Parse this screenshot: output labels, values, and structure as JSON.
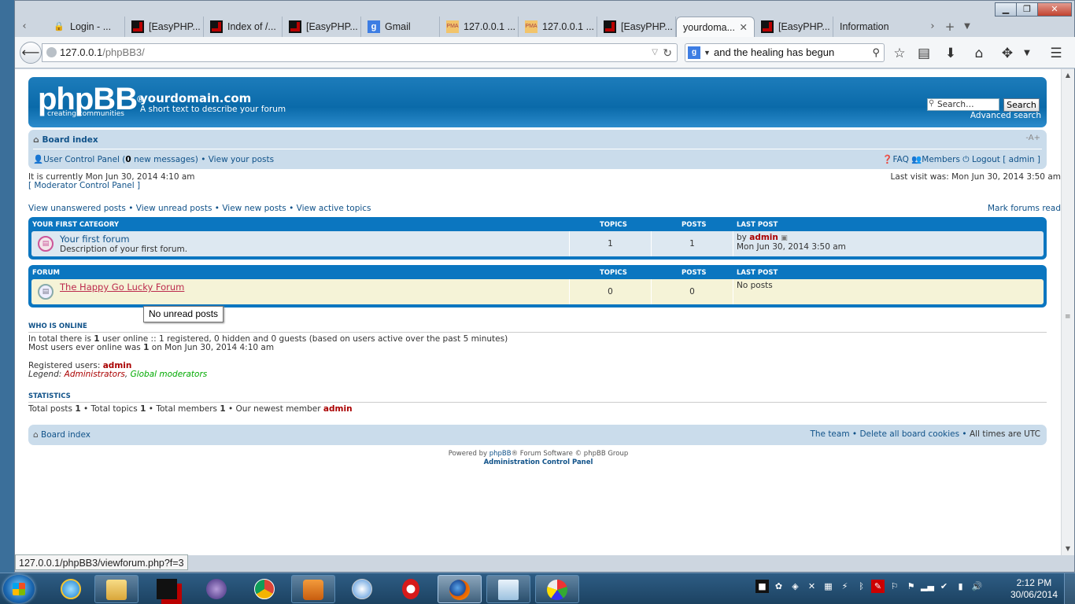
{
  "browser": {
    "tabs": [
      {
        "label": "Login - ...",
        "icon": "lock-icon"
      },
      {
        "label": "[EasyPHP...",
        "icon": "easyphp-icon"
      },
      {
        "label": "Index of /...",
        "icon": "easyphp-icon"
      },
      {
        "label": "[EasyPHP...",
        "icon": "easyphp-icon"
      },
      {
        "label": "Gmail",
        "icon": "google-icon"
      },
      {
        "label": "127.0.0.1 ...",
        "icon": "phpmyadmin-icon"
      },
      {
        "label": "127.0.0.1 ...",
        "icon": "phpmyadmin-icon"
      },
      {
        "label": "[EasyPHP...",
        "icon": "easyphp-icon"
      },
      {
        "label": "yourdoma...",
        "icon": "",
        "active": true
      },
      {
        "label": "[EasyPHP...",
        "icon": "easyphp-icon"
      },
      {
        "label": "Information",
        "icon": ""
      }
    ],
    "url_host": "127.0.0.1",
    "url_path": "/phpBB3/",
    "search_engine_letter": "g",
    "search_pma": "PMA",
    "search_text": "and the healing has begun",
    "status_url": "127.0.0.1/phpBB3/viewforum.php?f=3"
  },
  "header": {
    "logo": "phpBB",
    "logo_reg": "®",
    "logo_sub": "creating communities",
    "site_title": "yourdomain.com",
    "site_desc": "A short text to describe your forum",
    "search_placeholder": "Search…",
    "search_button": "Search",
    "advanced_search": "Advanced search"
  },
  "navbar": {
    "board_index": "Board index",
    "resize": "-A+",
    "ucp": "User Control Panel",
    "new_messages_count": "0",
    "new_messages_suffix": "new messages",
    "view_posts": "View your posts",
    "faq": "FAQ",
    "members": "Members",
    "logout": "Logout [ admin ]"
  },
  "info": {
    "current_time": "It is currently Mon Jun 30, 2014 4:10 am",
    "mcp": "[ Moderator Control Panel ]",
    "last_visit": "Last visit was: Mon Jun 30, 2014 3:50 am",
    "links": [
      "View unanswered posts",
      "View unread posts",
      "View new posts",
      "View active topics"
    ],
    "mark_read": "Mark forums read"
  },
  "categories": [
    {
      "name": "YOUR FIRST CATEGORY",
      "col_topics": "TOPICS",
      "col_posts": "POSTS",
      "col_last": "LAST POST",
      "forum": {
        "title": "Your first forum",
        "desc": "Description of your first forum.",
        "topics": "1",
        "posts": "1",
        "last_by": "by",
        "last_user": "admin",
        "last_time": "Mon Jun 30, 2014 3:50 am"
      }
    },
    {
      "name": "FORUM",
      "col_topics": "TOPICS",
      "col_posts": "POSTS",
      "col_last": "LAST POST",
      "forum": {
        "title": "The Happy Go Lucky Forum",
        "desc": "",
        "topics": "0",
        "posts": "0",
        "last_text": "No posts"
      }
    }
  ],
  "tooltip": "No unread posts",
  "online": {
    "heading": "WHO IS ONLINE",
    "line1_a": "In total there is",
    "line1_count": "1",
    "line1_b": "user online :: 1 registered, 0 hidden and 0 guests (based on users active over the past 5 minutes)",
    "line2_a": "Most users ever online was",
    "line2_count": "1",
    "line2_b": "on Mon Jun 30, 2014 4:10 am",
    "registered_label": "Registered users:",
    "registered_user": "admin",
    "legend_label": "Legend:",
    "legend_admins": "Administrators",
    "legend_mods": "Global moderators"
  },
  "stats": {
    "heading": "STATISTICS",
    "label_posts": "Total posts",
    "posts": "1",
    "label_topics": "Total topics",
    "topics": "1",
    "label_members": "Total members",
    "members": "1",
    "label_newest": "Our newest member",
    "newest": "admin"
  },
  "footer": {
    "board_index": "Board index",
    "team": "The team",
    "delete_cookies": "Delete all board cookies",
    "timezone": "All times are UTC",
    "powered_a": "Powered by",
    "powered_link": "phpBB",
    "powered_b": "® Forum Software © phpBB Group",
    "acp": "Administration Control Panel"
  },
  "taskbar": {
    "time": "2:12 PM",
    "date": "30/06/2014"
  },
  "colors": {
    "link": "#105289",
    "admin": "#aa0000",
    "mod": "#00aa00",
    "header": "#0b76c0"
  }
}
